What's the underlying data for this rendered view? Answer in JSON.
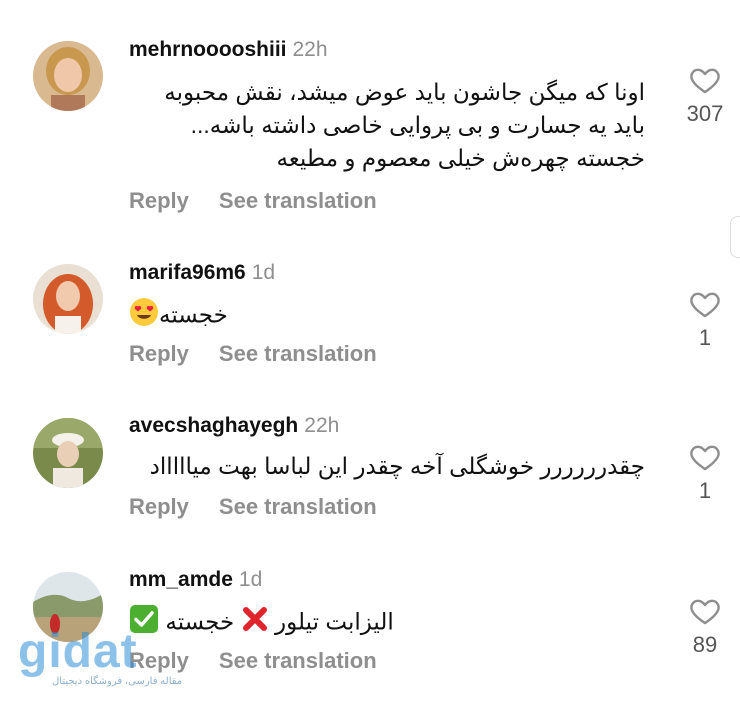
{
  "comments": [
    {
      "username": "mehrnooooshiii",
      "time": "22h",
      "lines": [
        "اونا که میگن جاشون باید عوض میشد، نقش محبوبه",
        "باید یه جسارت و بی پروایی خاصی داشته باشه...",
        "خجسته چهره‌ش خیلی معصوم و مطیعه"
      ],
      "likes": "307",
      "reply": "Reply",
      "translate": "See translation"
    },
    {
      "username": "marifa96m6",
      "time": "1d",
      "text": "خجسته",
      "emoji": "heart-eyes-emoji",
      "likes": "1",
      "reply": "Reply",
      "translate": "See translation"
    },
    {
      "username": "avecshaghayegh",
      "time": "22h",
      "text": "چقدرررررر خوشگلی آخه چقدر این لباسا بهت میاااااد",
      "likes": "1",
      "reply": "Reply",
      "translate": "See translation"
    },
    {
      "username": "mm_amde",
      "time": "1d",
      "text_a": "خجسته",
      "text_b": "الیزابت تیلور",
      "emoji_a": "red-x-emoji",
      "emoji_b": "green-check-emoji",
      "likes": "89",
      "reply": "Reply",
      "translate": "See translation"
    }
  ],
  "watermark": {
    "logo": "gidat",
    "tagline": "مقاله فارسی، فروشگاه دیجیتال"
  },
  "colors": {
    "muted": "#8e8e8e",
    "text": "#111111",
    "watermark": "#2f8fd8"
  }
}
